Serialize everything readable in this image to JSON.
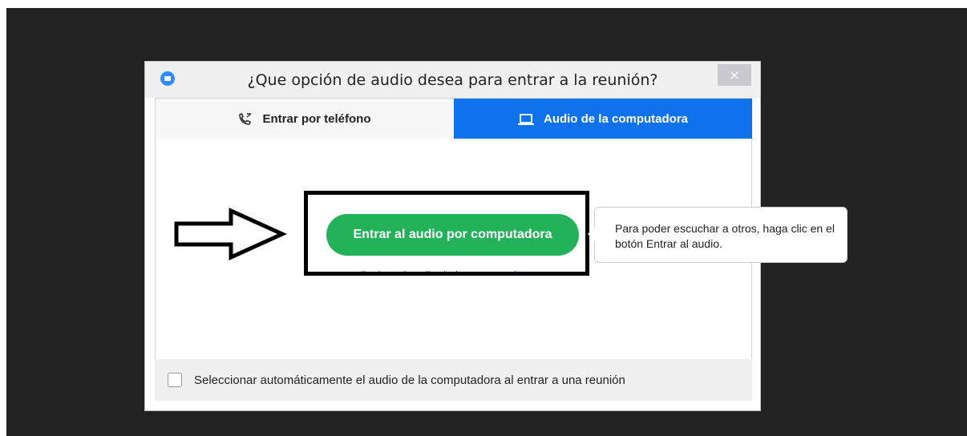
{
  "dialog": {
    "title": "¿Que opción de audio desea para entrar a la reunión?",
    "close_label": "×"
  },
  "tabs": [
    {
      "label": "Entrar por teléfono",
      "icon": "phone-icon",
      "active": false
    },
    {
      "label": "Audio de la computadora",
      "icon": "laptop-icon",
      "active": true
    }
  ],
  "main": {
    "join_button_label": "Entrar al audio por computadora",
    "test_link_label": "Probar el audio de la computadora"
  },
  "tooltip": {
    "text": "Para poder escuchar a otros, haga clic en el botón Entrar al audio."
  },
  "footer": {
    "checkbox_label": "Seleccionar automáticamente el audio de la computadora al entrar a una reunión",
    "checked": false
  },
  "colors": {
    "accent": "#0e72ed",
    "join_button": "#23b25a",
    "backdrop": "#222222"
  }
}
